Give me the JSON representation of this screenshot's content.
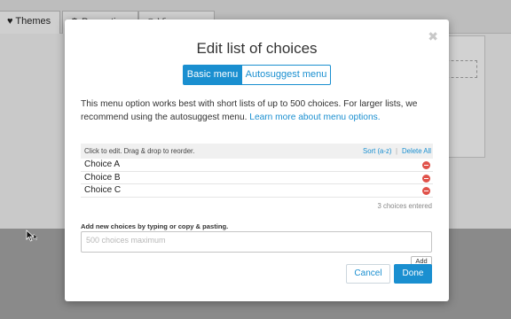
{
  "background": {
    "tabs": {
      "themes": "Themes",
      "properties": "Properties",
      "view": "View"
    }
  },
  "modal": {
    "title": "Edit list of choices",
    "close_icon": "close-icon",
    "tabs": {
      "basic": "Basic menu",
      "autosuggest": "Autosuggest menu",
      "active": "basic"
    },
    "description": "This menu option works best with short lists of up to 500 choices. For larger lists, we recommend using the autosuggest menu.",
    "learn_more": "Learn more about menu options.",
    "list_header": {
      "instructions": "Click to edit. Drag & drop to reorder.",
      "sort": "Sort (a-z)",
      "separator": "|",
      "delete_all": "Delete All"
    },
    "choices": [
      "Choice A",
      "Choice B",
      "Choice C"
    ],
    "choices_count": "3 choices entered",
    "add_label": "Add new choices by typing or copy & pasting.",
    "add_placeholder": "500 choices maximum",
    "add_button": "Add",
    "cancel_button": "Cancel",
    "done_button": "Done"
  },
  "colors": {
    "accent": "#1a8fd0",
    "delete": "#e0524a",
    "overlay": "#8f8f8f"
  }
}
